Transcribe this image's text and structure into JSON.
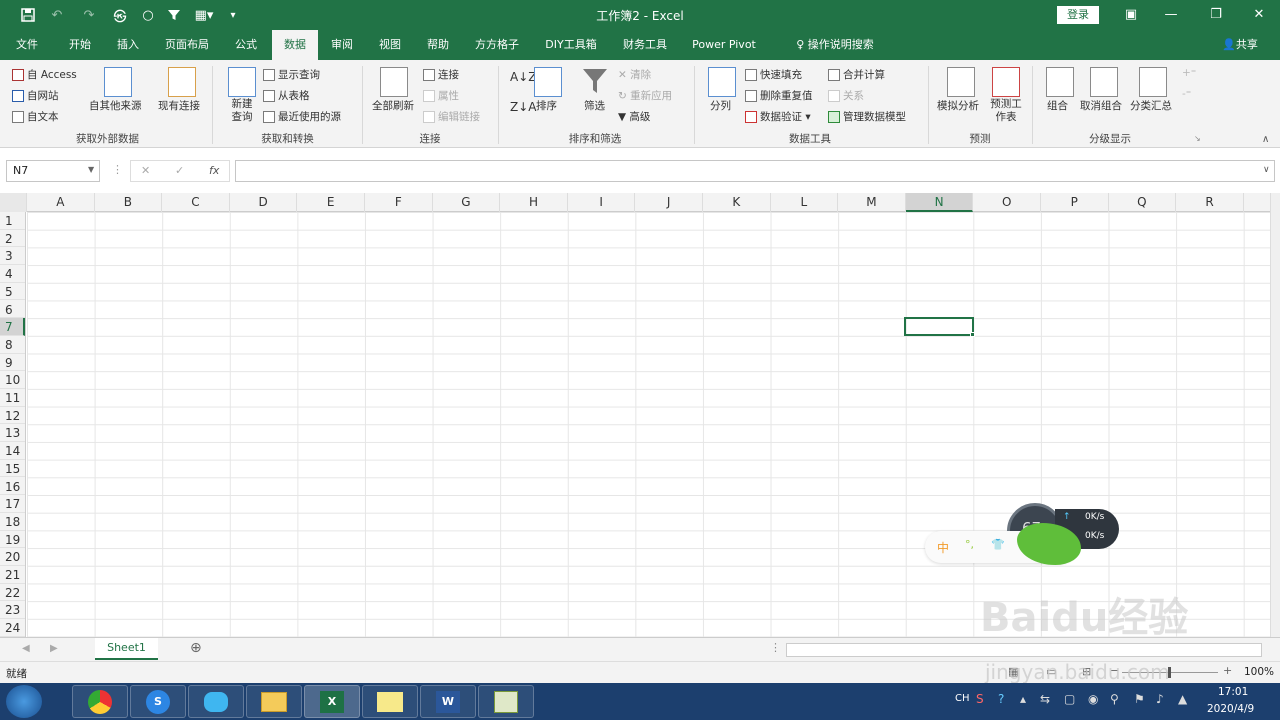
{
  "window": {
    "title": "工作簿2 - Excel",
    "login_label": "登录",
    "minimize": "—",
    "restore": "❐",
    "close": "✕",
    "ribbon_display": "▣"
  },
  "tabs": [
    {
      "label": "文件"
    },
    {
      "label": "开始"
    },
    {
      "label": "插入"
    },
    {
      "label": "页面布局"
    },
    {
      "label": "公式"
    },
    {
      "label": "数据",
      "active": true
    },
    {
      "label": "审阅"
    },
    {
      "label": "视图"
    },
    {
      "label": "帮助"
    },
    {
      "label": "方方格子"
    },
    {
      "label": "DIY工具箱"
    },
    {
      "label": "财务工具"
    },
    {
      "label": "Power Pivot"
    }
  ],
  "tell_me": "操作说明搜索",
  "share": "共享",
  "ribbon": {
    "get_external": {
      "group": "获取外部数据",
      "from_access": "自 Access",
      "from_web": "自网站",
      "from_text": "自文本",
      "other_sources": "自其他来源",
      "existing_conn": "现有连接"
    },
    "get_transform": {
      "group": "获取和转换",
      "new_query": "新建查询",
      "show_queries": "显示查询",
      "from_table": "从表格",
      "recent_sources": "最近使用的源"
    },
    "connections": {
      "group": "连接",
      "refresh_all": "全部刷新",
      "connections": "连接",
      "properties": "属性",
      "edit_links": "编辑链接"
    },
    "sort_filter": {
      "group": "排序和筛选",
      "sort": "排序",
      "filter": "筛选",
      "clear": "清除",
      "reapply": "重新应用",
      "advanced": "高级"
    },
    "data_tools": {
      "group": "数据工具",
      "text_to_columns": "分列",
      "flash_fill": "快速填充",
      "remove_dup": "删除重复值",
      "validation": "数据验证",
      "consolidate": "合并计算",
      "relationships": "关系",
      "data_model": "管理数据模型"
    },
    "forecast": {
      "group": "预测",
      "what_if": "模拟分析",
      "forecast_sheet": "预测工作表"
    },
    "outline": {
      "group": "分级显示",
      "group_btn": "组合",
      "ungroup": "取消组合",
      "subtotal": "分类汇总"
    }
  },
  "formula_bar": {
    "name_box": "N7",
    "cancel": "✕",
    "enter": "✓",
    "fx": "fx",
    "formula": ""
  },
  "columns": [
    "A",
    "B",
    "C",
    "D",
    "E",
    "F",
    "G",
    "H",
    "I",
    "J",
    "K",
    "L",
    "M",
    "N",
    "O",
    "P",
    "Q",
    "R"
  ],
  "rows": [
    "1",
    "2",
    "3",
    "4",
    "5",
    "6",
    "7",
    "8",
    "9",
    "10",
    "11",
    "12",
    "13",
    "14",
    "15",
    "16",
    "17",
    "18",
    "19",
    "20",
    "21",
    "22",
    "23",
    "24"
  ],
  "selected_col": "N",
  "selected_row": "7",
  "sheets": [
    {
      "label": "Sheet1"
    }
  ],
  "add_sheet": "⊕",
  "status": {
    "ready": "就绪",
    "zoom": "100%"
  },
  "widget": {
    "cpu": "67",
    "up": "0K/s",
    "down": "0K/s",
    "ime": "中"
  },
  "watermark": {
    "text": "Baidu经验",
    "url": "jingyan.baidu.com"
  },
  "taskbar": {
    "time": "17:01",
    "date": "2020/4/9",
    "lang": "CH"
  }
}
